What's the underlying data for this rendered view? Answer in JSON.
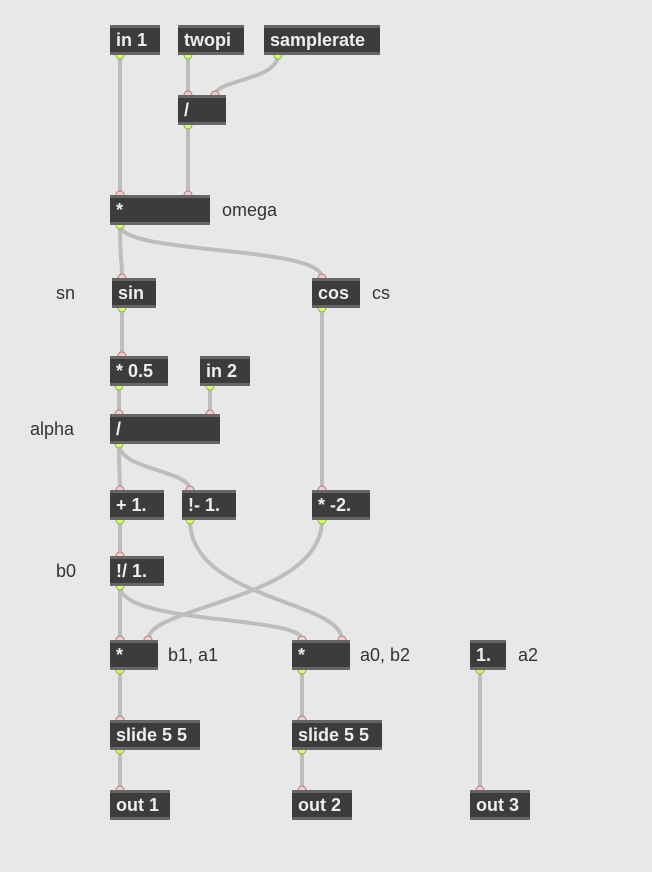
{
  "boxes": {
    "in1": "in 1",
    "twopi": "twopi",
    "samplerate": "samplerate",
    "div1": "/",
    "mul_omega": "*",
    "sin": "sin",
    "cos": "cos",
    "mul_half": "* 0.5",
    "in2": "in 2",
    "div_alpha": "/",
    "plus1": "+ 1.",
    "notminus1": "!- 1.",
    "mul_neg2": "* -2.",
    "notdiv1": "!/ 1.",
    "mul_b1a1": "*",
    "mul_a0b2": "*",
    "one": "1.",
    "slide1": "slide 5 5",
    "slide2": "slide 5 5",
    "out1": "out 1",
    "out2": "out 2",
    "out3": "out 3"
  },
  "labels": {
    "omega": "omega",
    "sn": "sn",
    "cs": "cs",
    "alpha": "alpha",
    "b0": "b0",
    "b1a1": "b1, a1",
    "a0b2": "a0, b2",
    "a2": "a2"
  }
}
